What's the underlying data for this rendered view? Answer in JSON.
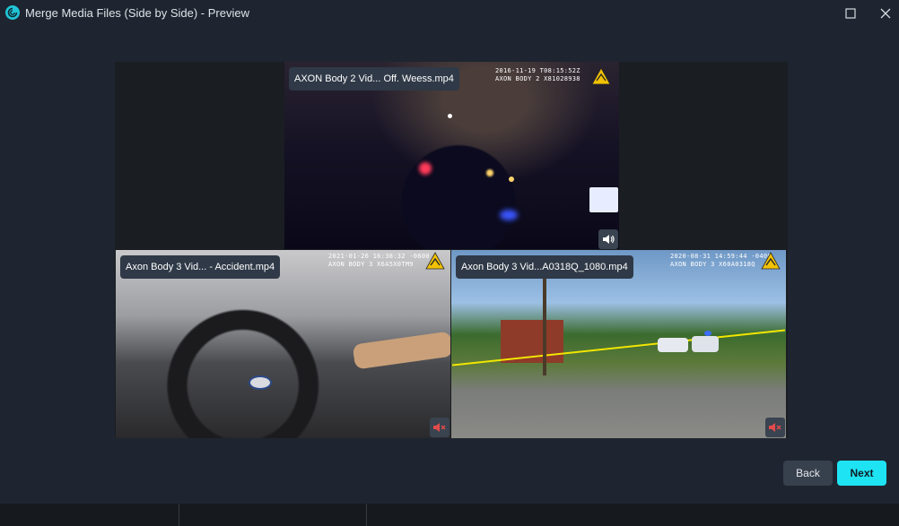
{
  "window": {
    "title": "Merge Media Files (Side by Side) - Preview"
  },
  "videos": [
    {
      "file_label": "AXON Body 2 Vid... Off. Weess.mp4",
      "stamp_line1": "2016-11-19 T08:15:52Z",
      "stamp_line2": "AXON BODY 2 X81028938",
      "volume": "on"
    },
    {
      "file_label": "Axon Body 3 Vid... - Accident.mp4",
      "stamp_line1": "2021-01-26 16:38:32 -0600",
      "stamp_line2": "AXON BODY 3 X6A5X0TM9",
      "volume": "muted"
    },
    {
      "file_label": "Axon Body 3 Vid...A0318Q_1080.mp4",
      "stamp_line1": "2020-08-31 14:59:44 -0400",
      "stamp_line2": "AXON BODY 3 X60A0318Q",
      "volume": "muted"
    }
  ],
  "buttons": {
    "back": "Back",
    "next": "Next"
  },
  "colors": {
    "accent": "#1ee3f2",
    "warning": "#f2c200",
    "muted": "#e24b4b"
  }
}
